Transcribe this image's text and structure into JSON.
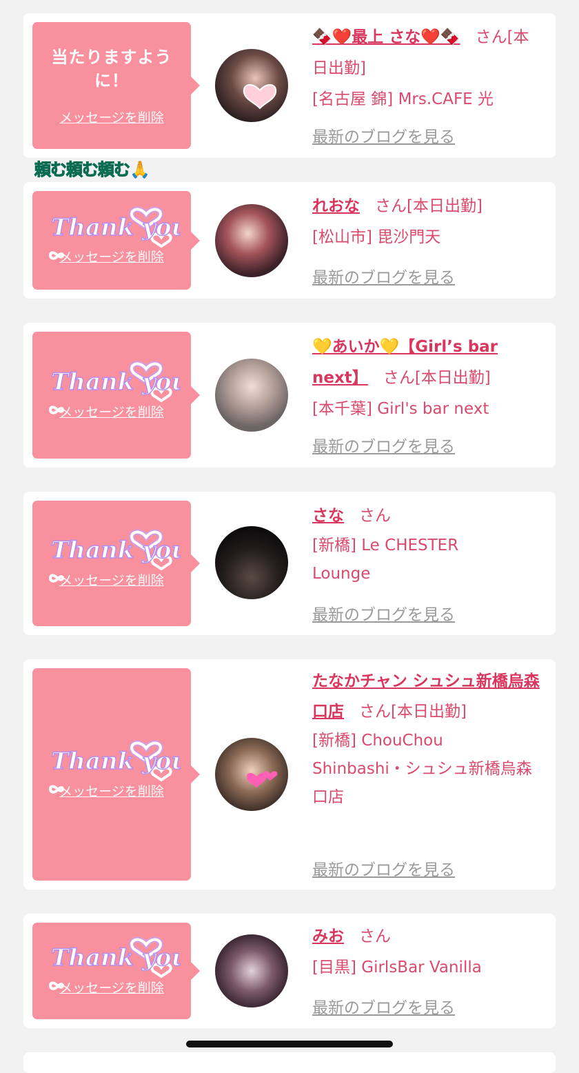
{
  "cards": [
    {
      "bubble_text": "当たりますように！",
      "delete_label": "メッセージを削除",
      "name": "🍫❤️最上 さな❤️🍫",
      "honorific": "さん",
      "status": "[本日出勤]",
      "location": "[名古屋 錦] Mrs.CAFE 光",
      "blog_label": "最新のブログを見る"
    },
    {
      "sticker": "Thank you",
      "delete_label": "メッセージを削除",
      "name": "れおな",
      "honorific": "さん",
      "status": "[本日出勤]",
      "location": "[松山市] 毘沙門天",
      "blog_label": "最新のブログを見る"
    },
    {
      "sticker": "Thank you",
      "delete_label": "メッセージを削除",
      "name": "💛あいか💛【Girl’s bar next】",
      "honorific": "さん",
      "status": "[本日出勤]",
      "location": "[本千葉] Girl's bar next",
      "blog_label": "最新のブログを見る"
    },
    {
      "sticker": "Thank you",
      "delete_label": "メッセージを削除",
      "name": "さな",
      "honorific": "さん",
      "status": "",
      "location": "[新橋] Le CHESTER Lounge",
      "blog_label": "最新のブログを見る"
    },
    {
      "sticker": "Thank you",
      "delete_label": "メッセージを削除",
      "name": "たなかチャン シュシュ新橋烏森口店",
      "honorific": "さん",
      "status": "[本日出勤]",
      "location": "[新橋] ChouChou Shinbashi・シュシュ新橋烏森口店",
      "blog_label": "最新のブログを見る"
    },
    {
      "sticker": "Thank you",
      "delete_label": "メッセージを削除",
      "name": "みお",
      "honorific": "さん",
      "status": "",
      "location": "[目黒] GirlsBar Vanilla",
      "blog_label": "最新のブログを見る"
    }
  ],
  "overlay_text": "頼む頼む頼む🙏",
  "colors": {
    "bubble": "#f8909e",
    "name": "#d9365e",
    "text": "#d94a6c",
    "link_gray": "#9a9a9a",
    "background": "#f2f2f2"
  }
}
